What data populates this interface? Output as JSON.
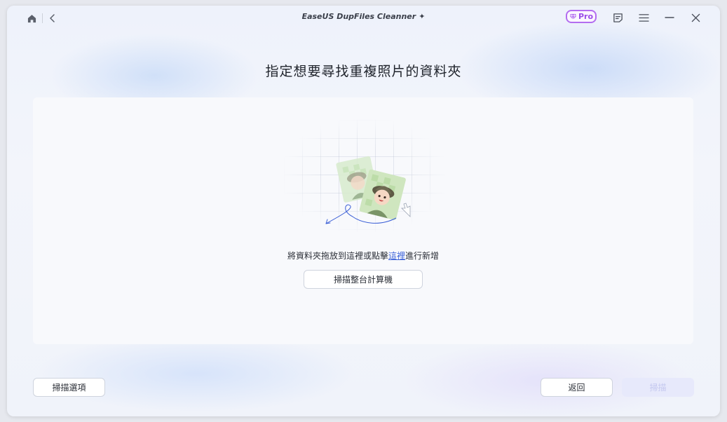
{
  "titlebar": {
    "app_title": "EaseUS DupFiles Cleanner",
    "pro_label": "Pro",
    "icons": {
      "home": "home-icon",
      "back": "chevron-left-icon",
      "sparkle": "sparkle-icon",
      "diamond": "diamond-icon",
      "feedback": "feedback-icon",
      "menu": "hamburger-icon",
      "minimize": "minimize-icon",
      "close": "close-icon"
    }
  },
  "main": {
    "heading": "指定想要尋找重複照片的資料夾",
    "drop_hint_before": "將資料夾拖放到這裡或點擊",
    "drop_hint_link": "這裡",
    "drop_hint_after": "進行新增",
    "scan_computer_label": "掃描整台計算機"
  },
  "footer": {
    "scan_options_label": "掃描選項",
    "back_label": "返回",
    "scan_label": "掃描"
  },
  "colors": {
    "accent": "#3d63d8",
    "pro_border": "#b36df0",
    "disabled_button": "#e7e9fb",
    "disabled_text": "#c4c8ef"
  }
}
